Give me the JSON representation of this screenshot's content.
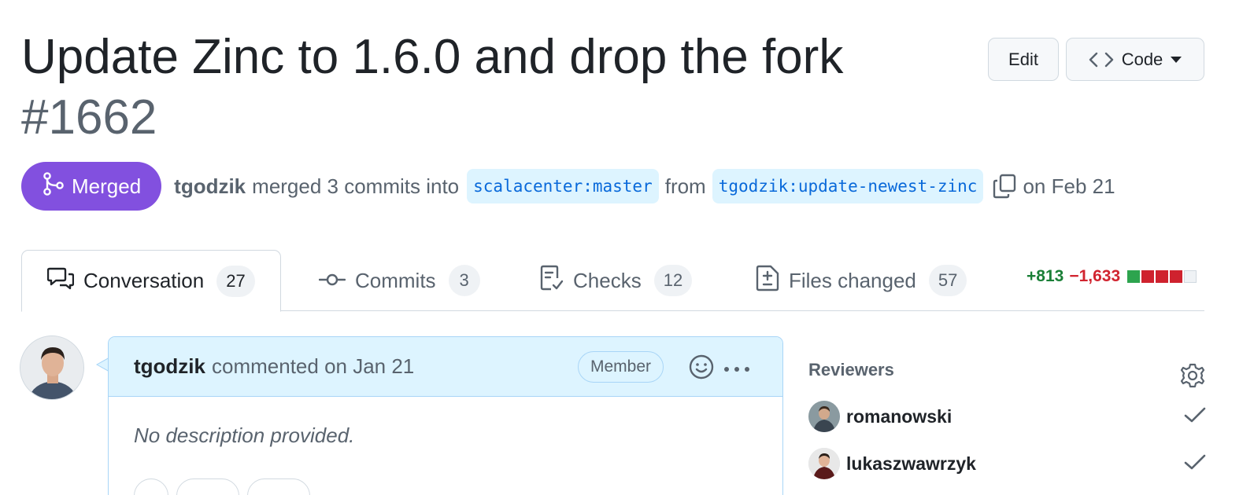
{
  "pr": {
    "title": "Update Zinc to 1.6.0 and drop the fork",
    "number": "#1662"
  },
  "header_actions": {
    "edit_label": "Edit",
    "code_label": "Code"
  },
  "meta": {
    "state": "Merged",
    "author": "tgodzik",
    "action_text": "merged 3 commits into",
    "base_branch": "scalacenter:master",
    "from_text": "from",
    "head_branch": "tgodzik:update-newest-zinc",
    "date_text": "on Feb 21"
  },
  "tabs": [
    {
      "label": "Conversation",
      "count": "27",
      "icon": "comment-discussion-icon"
    },
    {
      "label": "Commits",
      "count": "3",
      "icon": "git-commit-icon"
    },
    {
      "label": "Checks",
      "count": "12",
      "icon": "checklist-icon"
    },
    {
      "label": "Files changed",
      "count": "57",
      "icon": "file-diff-icon"
    }
  ],
  "diffstat": {
    "additions": "+813",
    "deletions": "−1,633",
    "blocks": [
      "#2da44e",
      "#cf222e",
      "#cf222e",
      "#cf222e",
      "#eff2f5"
    ]
  },
  "comment": {
    "author": "tgodzik",
    "meta_text": "commented on Jan 21",
    "role_badge": "Member",
    "body": "No description provided."
  },
  "sidebar": {
    "reviewers_title": "Reviewers",
    "reviewers": [
      {
        "name": "romanowski",
        "status": "approved"
      },
      {
        "name": "lukaszwawrzyk",
        "status": "approved"
      }
    ]
  },
  "colors": {
    "merged": "#8250df",
    "link": "#0969da",
    "additions": "#1a7f37",
    "deletions": "#d1242f"
  }
}
